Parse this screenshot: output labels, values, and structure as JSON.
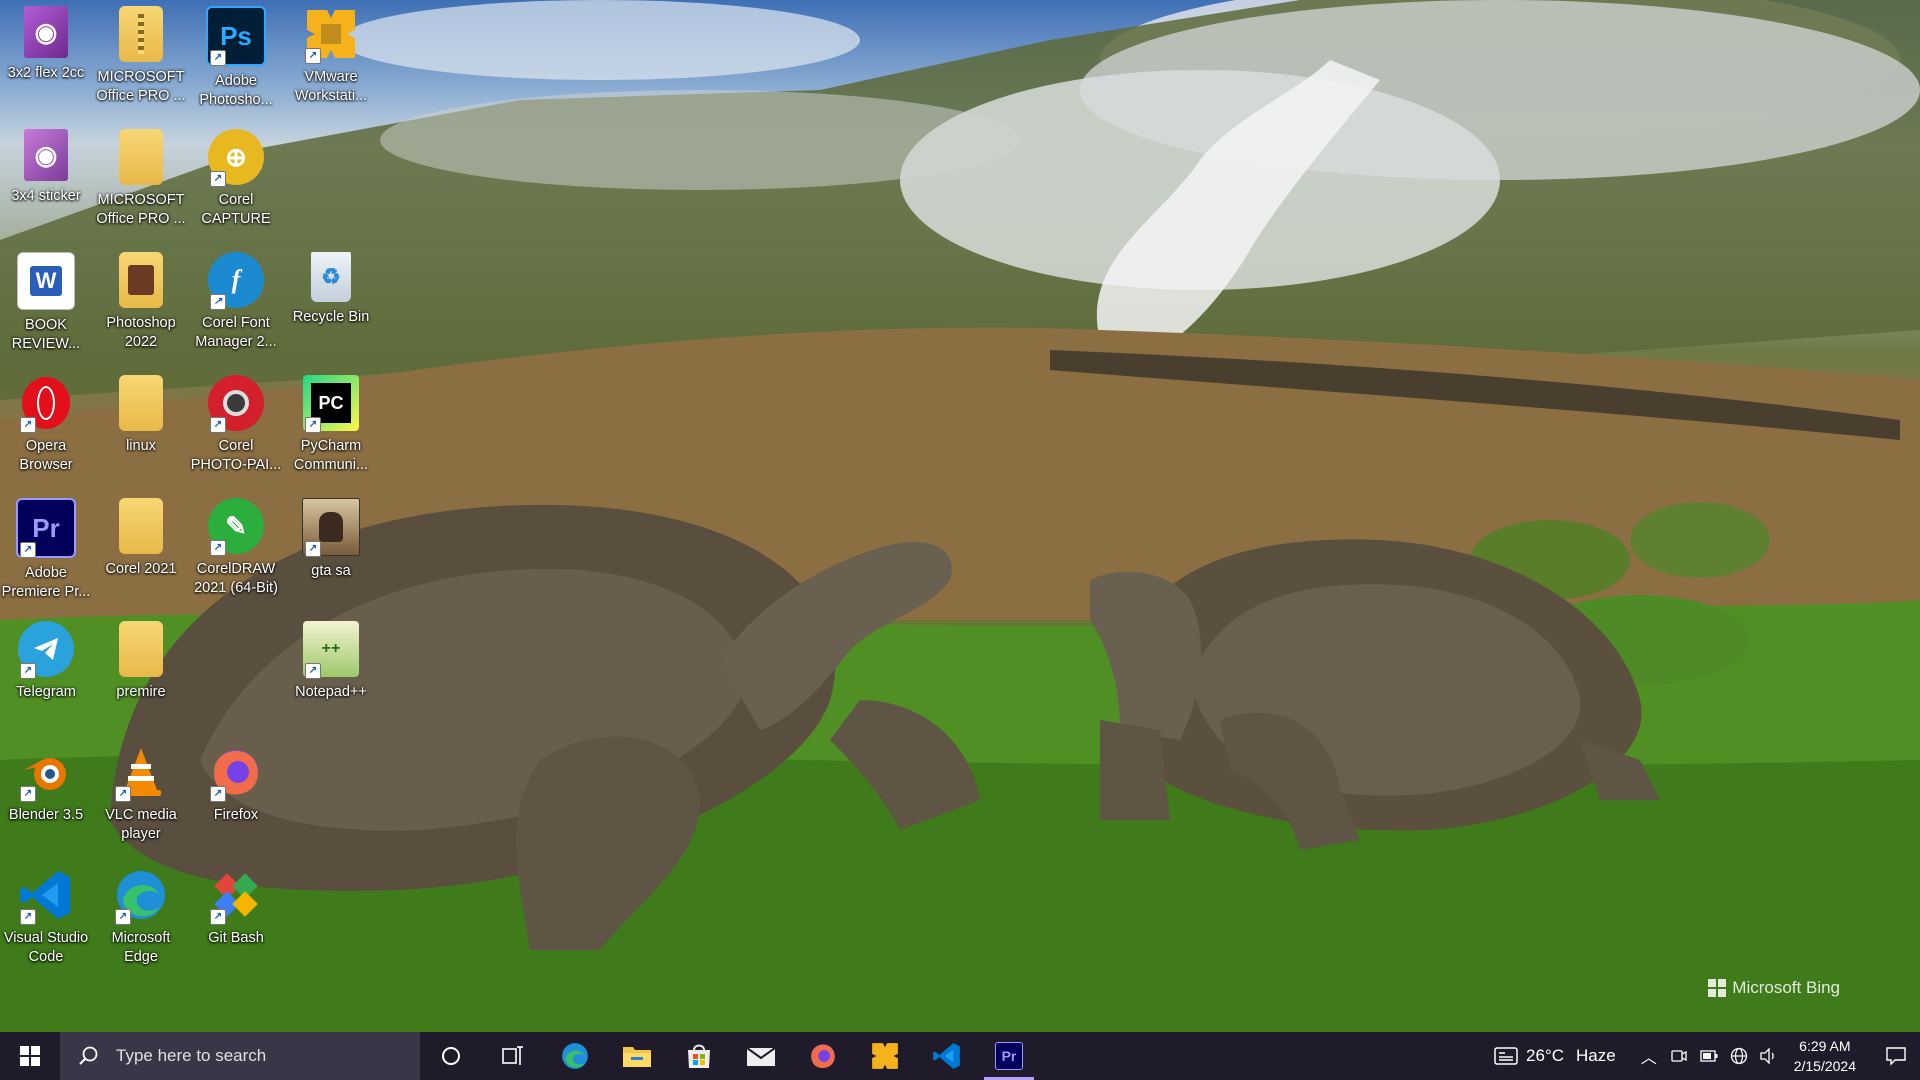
{
  "desktop": {
    "icons": [
      {
        "label": "3x2 flex 2cc"
      },
      {
        "label": "MICROSOFT Office PRO ..."
      },
      {
        "label": "Adobe Photosho..."
      },
      {
        "label": "VMware Workstati..."
      },
      {
        "label": "3x4 sticker"
      },
      {
        "label": "MICROSOFT Office PRO ..."
      },
      {
        "label": "Corel CAPTURE 2..."
      },
      {
        "label": "BOOK REVIEW..."
      },
      {
        "label": "Photoshop 2022"
      },
      {
        "label": "Corel Font Manager 2..."
      },
      {
        "label": "Recycle Bin"
      },
      {
        "label": "Opera Browser"
      },
      {
        "label": "linux"
      },
      {
        "label": "Corel PHOTO-PAI..."
      },
      {
        "label": "PyCharm Communi..."
      },
      {
        "label": "Adobe Premiere Pr..."
      },
      {
        "label": "Corel  2021"
      },
      {
        "label": "CorelDRAW 2021 (64-Bit)"
      },
      {
        "label": "gta sa"
      },
      {
        "label": "Telegram"
      },
      {
        "label": "premire"
      },
      {
        "label": "Notepad++"
      },
      {
        "label": "Blender 3.5"
      },
      {
        "label": "VLC media player"
      },
      {
        "label": "Firefox"
      },
      {
        "label": "Visual Studio Code"
      },
      {
        "label": "Microsoft Edge"
      },
      {
        "label": "Git Bash"
      }
    ]
  },
  "wallpaper": {
    "watermark": "Microsoft Bing"
  },
  "taskbar": {
    "search_placeholder": "Type here to search",
    "pinned": [
      "cortana-icon",
      "task-view-icon",
      "edge-icon",
      "file-explorer-icon",
      "store-icon",
      "mail-icon",
      "firefox-icon",
      "vmware-icon",
      "vscode-icon",
      "premiere-icon"
    ],
    "active_app": "premiere-icon",
    "weather": {
      "temp": "26°C",
      "condition": "Haze"
    },
    "clock": {
      "time": "6:29 AM",
      "date": "2/15/2024"
    }
  },
  "colors": {
    "taskbar_bg": "#1f1b2a",
    "search_bg": "#3b3548",
    "active_indicator": "#b4a0ff"
  }
}
